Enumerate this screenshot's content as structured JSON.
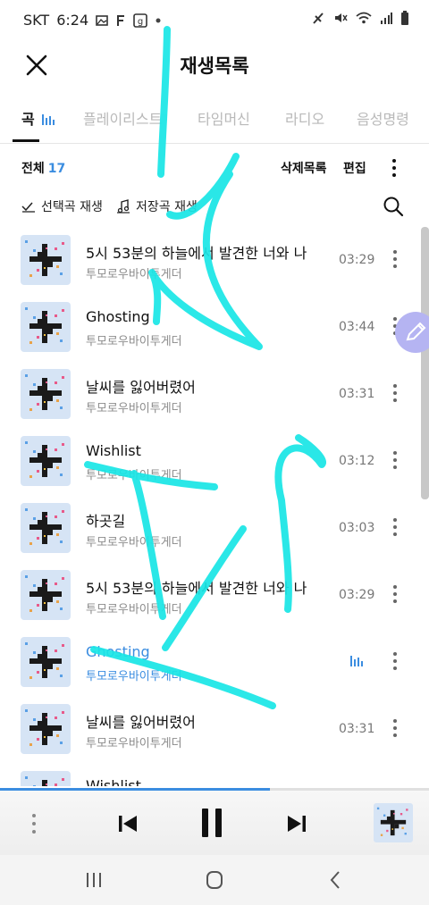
{
  "status_bar": {
    "carrier": "SKT",
    "time": "6:24",
    "left_icons": [
      "gallery-icon",
      "f-app-icon",
      "g-app-icon",
      "dot-icon"
    ],
    "right_icons": [
      "nfc-icon",
      "mute-icon",
      "wifi-icon",
      "signal-icon",
      "battery-icon"
    ]
  },
  "header": {
    "title": "재생목록",
    "close_icon": "close-icon"
  },
  "tabs": [
    {
      "label": "곡",
      "active": true
    },
    {
      "label": "플레이리스트",
      "active": false
    },
    {
      "label": "타임머신",
      "active": false
    },
    {
      "label": "라디오",
      "active": false
    },
    {
      "label": "음성명령",
      "active": false
    }
  ],
  "subheader": {
    "total_label": "전체",
    "total_count": "17",
    "deleted_list": "삭제목록",
    "edit": "편집"
  },
  "actions": {
    "play_selected": "선택곡 재생",
    "play_saved": "저장곡 재생"
  },
  "songs": [
    {
      "title": "5시 53분의 하늘에서 발견한 너와 나",
      "artist": "투모로우바이투게더",
      "duration": "03:29",
      "playing": false
    },
    {
      "title": "Ghosting",
      "artist": "투모로우바이투게더",
      "duration": "03:44",
      "playing": false
    },
    {
      "title": "날씨를 잃어버렸어",
      "artist": "투모로우바이투게더",
      "duration": "03:31",
      "playing": false
    },
    {
      "title": "Wishlist",
      "artist": "투모로우바이투게더",
      "duration": "03:12",
      "playing": false
    },
    {
      "title": "하곳길",
      "artist": "투모로우바이투게더",
      "duration": "03:03",
      "playing": false
    },
    {
      "title": "5시 53분의 하늘에서 발견한 너와 나",
      "artist": "투모로우바이투게더",
      "duration": "03:29",
      "playing": false
    },
    {
      "title": "Ghosting",
      "artist": "투모로우바이투게더",
      "duration": "",
      "playing": true
    },
    {
      "title": "날씨를 잃어버렸어",
      "artist": "투모로우바이투게더",
      "duration": "03:31",
      "playing": false
    },
    {
      "title": "Wishlist",
      "artist": "",
      "duration": "",
      "playing": false
    }
  ],
  "player": {
    "progress_fraction": 0.63,
    "controls": [
      "previous-icon",
      "pause-icon",
      "next-icon"
    ]
  },
  "nav_bar": [
    "recent-apps-icon",
    "home-icon",
    "back-icon"
  ],
  "colors": {
    "accent": "#3b8de0",
    "annotation": "#19e6e6",
    "fab": "#b5b4f2"
  }
}
